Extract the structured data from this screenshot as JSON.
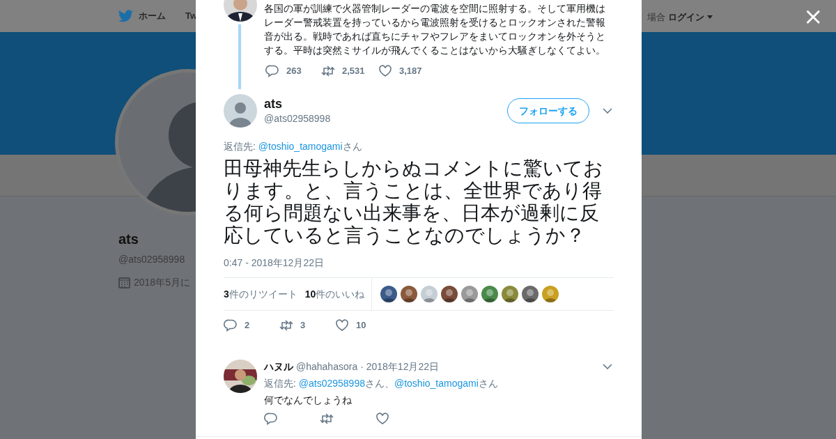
{
  "background_page": {
    "nav": {
      "home": "ホーム",
      "cut_item": "Tw",
      "login_prefix": "場合",
      "login": "ログイン"
    },
    "profile": {
      "name": "ats",
      "handle": "@ats02958998",
      "joined": "2018年5月に"
    }
  },
  "close_button": "×",
  "parent_tweet": {
    "text": "各国の軍が訓練で火器管制レーダーの電波を空間に照射する。そして軍用機はレーダー警戒装置を持っているから電波照射を受けるとロックオンされた警報音が出る。戦時であれば直ちにチャフやフレアをまいてロックオンを外そうとする。平時は突然ミサイルが飛んでくることはないから大騒ぎしなくてよい。",
    "actions": [
      {
        "kind": "reply",
        "count": "263"
      },
      {
        "kind": "retweet",
        "count": "2,531"
      },
      {
        "kind": "like",
        "count": "3,187"
      }
    ]
  },
  "tweet": {
    "name": "ats",
    "handle": "@ats02958998",
    "follow_button": "フォローする",
    "reply_to": {
      "prefix": "返信先: ",
      "mentions": [
        {
          "handle": "@toshio_tamogami",
          "suffix": "さん"
        }
      ]
    },
    "text": "田母神先生らしからぬコメントに驚いております。と、言うことは、全世界であり得る何ら問題ない出来事を、日本が過剰に反応していると言うことなのでしょうか？",
    "time": "0:47 - 2018年12月22日",
    "stats": [
      {
        "count": "3",
        "label": "件のリツイート"
      },
      {
        "count": "10",
        "label": "件のいいね"
      }
    ],
    "liker_avatars": [
      {
        "color": "#3b5b8a"
      },
      {
        "color": "#8a5a3c"
      },
      {
        "color": "#c5cdd5"
      },
      {
        "color": "#7a4b3a"
      },
      {
        "color": "#9a9a9a"
      },
      {
        "color": "#4a8a4a"
      },
      {
        "color": "#8a8a3a"
      },
      {
        "color": "#6a6a6a"
      },
      {
        "color": "#c9a020"
      }
    ],
    "actions": [
      {
        "kind": "reply",
        "count": "2"
      },
      {
        "kind": "retweet",
        "count": "3"
      },
      {
        "kind": "like",
        "count": "10"
      }
    ]
  },
  "replies": [
    {
      "name": "ハヌル",
      "handle": "@hahahasora",
      "date": "· 2018年12月22日",
      "reply_to": {
        "prefix": "返信先: ",
        "mentions": [
          {
            "handle": "@ats02958998",
            "suffix": "さん、"
          },
          {
            "handle": "@toshio_tamogami",
            "suffix": "さん"
          }
        ]
      },
      "text": "何でなんでしょうね",
      "actions": [
        {
          "kind": "reply"
        },
        {
          "kind": "retweet"
        },
        {
          "kind": "like"
        }
      ]
    }
  ]
}
